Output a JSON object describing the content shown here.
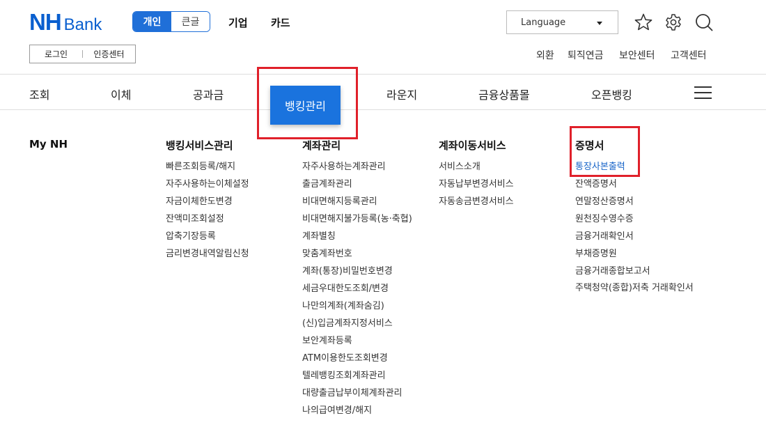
{
  "header": {
    "logo_nh": "NH",
    "logo_bank": "Bank",
    "mode_personal": "개인",
    "mode_large": "큰글",
    "top_links": [
      "기업",
      "카드"
    ],
    "language_label": "Language",
    "auth": [
      "로그인",
      "인증센터"
    ],
    "util_links": [
      "외환",
      "퇴직연금",
      "보안센터",
      "고객센터"
    ]
  },
  "gnb": {
    "items": [
      "조회",
      "이체",
      "공과금",
      "뱅킹관리",
      "라운지",
      "금융상품몰",
      "오픈뱅킹"
    ],
    "active": "뱅킹관리"
  },
  "menu": {
    "columns": [
      {
        "title": "My NH",
        "items": []
      },
      {
        "title": "뱅킹서비스관리",
        "items": [
          "빠른조회등록/해지",
          "자주사용하는이체설정",
          "자금이체한도변경",
          "잔액미조회설정",
          "압축기장등록",
          "금리변경내역알림신청"
        ]
      },
      {
        "title": "계좌관리",
        "items": [
          "자주사용하는계좌관리",
          "출금계좌관리",
          "비대면해지등록관리",
          "비대면해지불가등록(농·축협)",
          "계좌별칭",
          "맞춤계좌번호",
          "계좌(통장)비밀번호변경",
          "세금우대한도조회/변경",
          "나만의계좌(계좌숨김)",
          "(신)입금계좌지정서비스",
          "보안계좌등록",
          "ATM이용한도조회변경",
          "텔레뱅킹조회계좌관리",
          "대량출금납부이체계좌관리",
          "나의급여변경/해지"
        ]
      },
      {
        "title": "계좌이동서비스",
        "items": [
          "서비스소개",
          "자동납부변경서비스",
          "자동송금변경서비스"
        ]
      },
      {
        "title": "증명서",
        "items": [
          "통장사본출력",
          "잔액증명서",
          "연말정산증명서",
          "원천징수영수증",
          "금융거래확인서",
          "부채증명원",
          "금융거래종합보고서",
          "주택청약(종합)저축 거래확인서"
        ],
        "active": "통장사본출력"
      }
    ]
  },
  "colors": {
    "brand": "#0a5fcf",
    "active_tab": "#1a73de",
    "highlight_box": "#e0202a",
    "active_link": "#1a66c9"
  },
  "icons": [
    "star-icon",
    "gear-icon",
    "search-icon",
    "hamburger-icon"
  ]
}
